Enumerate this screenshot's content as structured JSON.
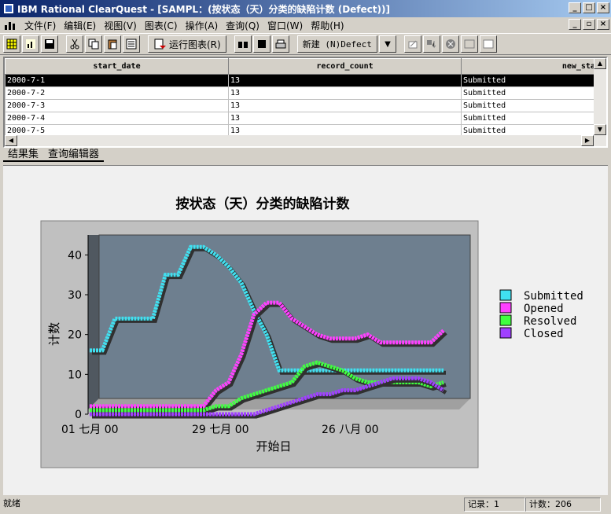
{
  "window": {
    "title": "IBM Rational ClearQuest - [SAMPL：(按状态（天）分类的缺陷计数 (Defect))]"
  },
  "menu": {
    "items": [
      "文件(F)",
      "编辑(E)",
      "视图(V)",
      "图表(C)",
      "操作(A)",
      "查询(Q)",
      "窗口(W)",
      "帮助(H)"
    ]
  },
  "toolbar": {
    "run_chart_label": "运行图表(R)",
    "new_label": "新建 (N)Defect"
  },
  "grid": {
    "columns": [
      "start_date",
      "record_count",
      "new_state"
    ],
    "rows": [
      [
        "2000-7-1",
        "13",
        "Submitted"
      ],
      [
        "2000-7-2",
        "13",
        "Submitted"
      ],
      [
        "2000-7-3",
        "13",
        "Submitted"
      ],
      [
        "2000-7-4",
        "13",
        "Submitted"
      ],
      [
        "2000-7-5",
        "13",
        "Submitted"
      ]
    ]
  },
  "tabs": [
    "结果集",
    "查询编辑器"
  ],
  "status": {
    "ready": "就绪",
    "record": "记录：1",
    "count": "计数：206"
  },
  "chart_data": {
    "type": "line",
    "title": "按状态（天）分类的缺陷计数",
    "xlabel": "开始日",
    "ylabel": "计数",
    "ylim": [
      0,
      45
    ],
    "yticks": [
      0,
      10,
      20,
      30,
      40
    ],
    "xtick_labels": [
      "01 七月 00",
      "29 七月 00",
      "26 八月 00"
    ],
    "legend_position": "right",
    "colors": {
      "Submitted": "#40e0f0",
      "Opened": "#ff40ff",
      "Resolved": "#40ff40",
      "Closed": "#a040ff"
    },
    "x": [
      0,
      3,
      6,
      9,
      12,
      15,
      18,
      21,
      24,
      27,
      30,
      33,
      36,
      39,
      42,
      45,
      48,
      51,
      54,
      57,
      60,
      63,
      66,
      69,
      72,
      75,
      78,
      81,
      84
    ],
    "series": [
      {
        "name": "Submitted",
        "values": [
          16,
          16,
          24,
          24,
          24,
          24,
          35,
          35,
          42,
          42,
          40,
          37,
          33,
          26,
          20,
          11,
          11,
          11,
          11,
          11,
          11,
          11,
          11,
          11,
          11,
          11,
          11,
          11,
          11
        ]
      },
      {
        "name": "Opened",
        "values": [
          2,
          2,
          2,
          2,
          2,
          2,
          2,
          2,
          2,
          2,
          6,
          8,
          15,
          25,
          28,
          28,
          24,
          22,
          20,
          19,
          19,
          19,
          20,
          18,
          18,
          18,
          18,
          18,
          21
        ]
      },
      {
        "name": "Resolved",
        "values": [
          1,
          1,
          1,
          1,
          1,
          1,
          1,
          1,
          1,
          1,
          2,
          2,
          4,
          5,
          6,
          7,
          8,
          12,
          13,
          12,
          11,
          9,
          8,
          8,
          8,
          8,
          8,
          7,
          8
        ]
      },
      {
        "name": "Closed",
        "values": [
          0,
          0,
          0,
          0,
          0,
          0,
          0,
          0,
          0,
          0,
          0,
          0,
          0,
          0,
          1,
          2,
          3,
          4,
          5,
          5,
          6,
          6,
          7,
          8,
          9,
          9,
          9,
          8,
          6
        ]
      }
    ]
  }
}
